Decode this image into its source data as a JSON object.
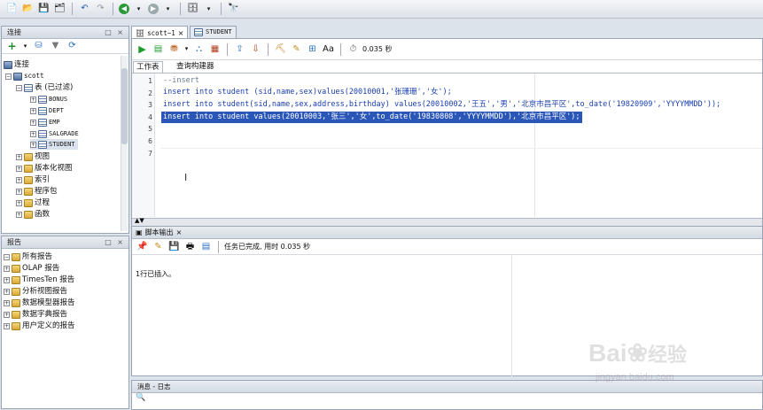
{
  "left_panel": {
    "connections_title": "连接",
    "reports_title": "报告",
    "tree_root": "连接",
    "connection_name": "scott",
    "tables_label": "表 (已过滤)",
    "tables": [
      "BONUS",
      "DEPT",
      "EMP",
      "SALGRADE",
      "STUDENT"
    ],
    "other_nodes": [
      "视图",
      "版本化视图",
      "索引",
      "程序包",
      "过程",
      "函数"
    ],
    "reports": [
      "所有报告",
      "OLAP 报告",
      "TimesTen 报告",
      "分析视图报告",
      "数据模型器报告",
      "数据字典报告",
      "用户定义的报告"
    ]
  },
  "editor": {
    "tabs": [
      "scott~1",
      "STUDENT"
    ],
    "exec_time": "0.035 秒",
    "sub_tabs": [
      "工作表",
      "查询构建器"
    ],
    "line_numbers": [
      "1",
      "2",
      "3",
      "4",
      "5",
      "6",
      "7"
    ],
    "lines": [
      "--insert",
      "insert into student (sid,name,sex)values(20010001,'张珊珊','女');",
      "insert into student(sid,name,sex,address,birthday) values(20010002,'王五','男','北京市昌平区',to_date('19820909','YYYYMMDD'));",
      "insert into student values(20010003,'张三','女',to_date('19830808','YYYYMMDD'),'北京市昌平区');"
    ]
  },
  "output": {
    "tab_label": "脚本输出",
    "status": "任务已完成, 用时 0.035 秒",
    "result": "1行已插入。"
  },
  "bottom": {
    "log_title": "消息 - 日志"
  },
  "watermark": {
    "brand": "Bai",
    "brand2": "经验",
    "url": "jingyan.baidu.com"
  }
}
